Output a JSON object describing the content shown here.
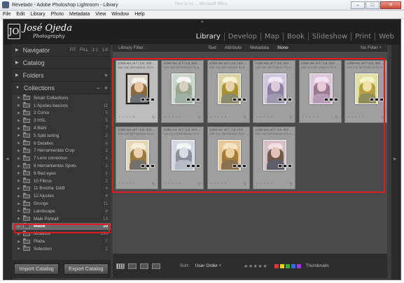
{
  "window": {
    "title": "Revelado - Adobe Photoshop Lightroom - Library",
    "faded_title": "Plex la mi ... Microsoft Word",
    "minimize": "–",
    "maximize": "□",
    "close": "✕"
  },
  "menu": [
    "File",
    "Edit",
    "Library",
    "Photo",
    "Metadata",
    "View",
    "Window",
    "Help"
  ],
  "logo": {
    "name": "José Ojeda",
    "sub": "Photography",
    "mark": "JO"
  },
  "modules": [
    {
      "label": "Library",
      "active": true
    },
    {
      "label": "Develop",
      "active": false
    },
    {
      "label": "Map",
      "active": false
    },
    {
      "label": "Book",
      "active": false
    },
    {
      "label": "Slideshow",
      "active": false
    },
    {
      "label": "Print",
      "active": false
    },
    {
      "label": "Web",
      "active": false
    }
  ],
  "left_panel": {
    "navigator": {
      "label": "Navigator",
      "options": [
        "FIT",
        "FILL",
        "1:1",
        "1:8"
      ]
    },
    "catalog": {
      "label": "Catalog"
    },
    "folders": {
      "label": "Folders",
      "plus": "+"
    },
    "collections": {
      "label": "Collections",
      "minus": "−",
      "plus": "+"
    },
    "items": [
      {
        "label": "Smart Collections",
        "count": ""
      },
      {
        "label": "1 Ajustes basicos",
        "count": "11"
      },
      {
        "label": "2 Curva",
        "count": "5"
      },
      {
        "label": "3 HSL",
        "count": "5"
      },
      {
        "label": "4 B&N",
        "count": "7"
      },
      {
        "label": "5 Split toning",
        "count": "2"
      },
      {
        "label": "6 Detalles",
        "count": "6"
      },
      {
        "label": "7 Herramientas Crop",
        "count": "1"
      },
      {
        "label": "7 Lens correction",
        "count": "1"
      },
      {
        "label": "8 Herramientas Spots",
        "count": "1"
      },
      {
        "label": "9 Red eyes",
        "count": "1"
      },
      {
        "label": "10 Filtros",
        "count": "2"
      },
      {
        "label": "11 Brocha: D&B",
        "count": "4"
      },
      {
        "label": "12 Ajustes",
        "count": "4"
      },
      {
        "label": "Grunge",
        "count": "11"
      },
      {
        "label": "Landscape",
        "count": "8"
      },
      {
        "label": "Male Portrait",
        "count": "13"
      },
      {
        "label": "Matte",
        "count": "10"
      },
      {
        "label": "Modelos",
        "count": "196"
      },
      {
        "label": "Plaza",
        "count": "7"
      },
      {
        "label": "Selection",
        "count": "1"
      }
    ],
    "selected_index": 17,
    "import_button": "Import Catalog",
    "export_button": "Export Catalog"
  },
  "filter_bar": {
    "label": "Library Filter :",
    "options": [
      {
        "label": "Text",
        "active": false
      },
      {
        "label": "Attribute",
        "active": false
      },
      {
        "label": "Metadata",
        "active": false
      },
      {
        "label": "None",
        "active": true
      }
    ],
    "no_filter": "No Filter ÷"
  },
  "grid": {
    "info_line1": "1/250 sec at f / 2,8, ISO ...",
    "info_line2": "100 mm (EF100mm f/2.8 ...",
    "stars": "• • • • •",
    "rotate": "↻",
    "cells": [
      {
        "tint": "#d8d2c8",
        "hat": "#f4f1ea",
        "hair": "#8a6a3c",
        "skin": "#e8c7a5",
        "body": "#6a6f74"
      },
      {
        "tint": "#c9d6cd",
        "hat": "#f3f6f3",
        "hair": "#9aa68f",
        "skin": "#d8cfc2",
        "body": "#9fb0a7"
      },
      {
        "tint": "#d9d3a6",
        "hat": "#f6f0d4",
        "hair": "#a8912e",
        "skin": "#e5d1a7",
        "body": "#8b8a6a"
      },
      {
        "tint": "#cfc6dd",
        "hat": "#efe9f6",
        "hair": "#8e7f9e",
        "skin": "#dccbd9",
        "body": "#9e98b0"
      },
      {
        "tint": "#dcc6d9",
        "hat": "#f4e4f1",
        "hair": "#9a7a8f",
        "skin": "#e8c9d8",
        "body": "#b79ab8"
      },
      {
        "tint": "#e3dfa3",
        "hat": "#f6f2c8",
        "hair": "#b3a040",
        "skin": "#efe0a8",
        "body": "#8f8c5c"
      },
      {
        "tint": "#e4d7b8",
        "hat": "#f7eedc",
        "hair": "#9b7a42",
        "skin": "#ecd3b0",
        "body": "#74716b"
      },
      {
        "tint": "#d3d8e0",
        "hat": "#f3f5f8",
        "hair": "#8a8f9a",
        "skin": "#dadde3",
        "body": "#b5bac5"
      },
      {
        "tint": "#e6c99a",
        "hat": "#f7e6c5",
        "hair": "#a47a3e",
        "skin": "#efcf9f",
        "body": "#8a7250"
      },
      {
        "tint": "#d6c0c8",
        "hat": "#f1dfe4",
        "hair": "#6e5a4a",
        "skin": "#e2c3b6",
        "body": "#5f5f6a"
      }
    ]
  },
  "toolbar": {
    "sort_label": "Sort:",
    "sort_value": "User Order ÷",
    "stars": "★★★★★",
    "swatches": [
      "#d83a3a",
      "#e6cf2a",
      "#3cae3c",
      "#3a6ed8",
      "#9a3ad8"
    ],
    "thumbnails_label": "Thumbnails"
  }
}
